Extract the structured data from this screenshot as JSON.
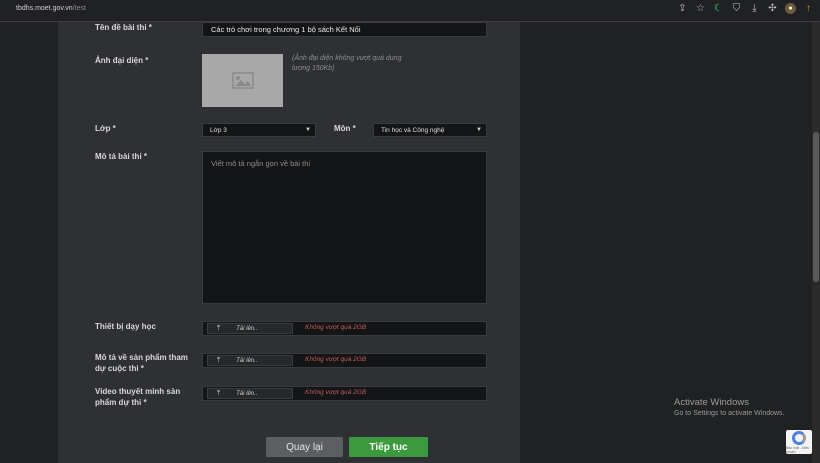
{
  "browser": {
    "url_host": "tbdhs.moet.gov.vn",
    "url_path": "/test"
  },
  "form": {
    "title_label": "Tên đề bài thi *",
    "title_value": "Các trò chơi trong chương 1 bộ sách Kết Nối",
    "avatar_label": "Ảnh đại diện *",
    "avatar_hint": "(Ảnh đại diện không vượt quá dung lượng 150Kb)",
    "grade_label": "Lớp *",
    "grade_value": "Lớp 3",
    "subject_label": "Môn *",
    "subject_value": "Tin học và Công nghệ",
    "desc_label": "Mô tả bài thi *",
    "desc_placeholder": "Viết mô tả ngắn gọn về bài thi",
    "uploads": [
      {
        "label": "Thiết bị dạy học",
        "button": "Tải lên..",
        "limit": "Không vượt quá 2GB"
      },
      {
        "label": "Mô tả về sản phẩm tham dự cuộc thi *",
        "button": "Tải lên..",
        "limit": "Không vượt quá 2GB"
      },
      {
        "label": "Video thuyết minh sản phẩm dự thi *",
        "button": "Tải lên..",
        "limit": "Không vượt quá 2GB"
      }
    ],
    "back_button": "Quay lại",
    "next_button": "Tiếp tục"
  },
  "overlay": {
    "activate_title": "Activate Windows",
    "activate_subtitle": "Go to Settings to activate Windows.",
    "captcha_text": "Bảo mật - Điều khoản"
  },
  "icons": [
    "share-icon",
    "star-icon",
    "moon-icon",
    "shield-icon",
    "download-icon",
    "puzzle-icon",
    "avatar-icon",
    "update-icon",
    "image-placeholder-icon",
    "upload-icon",
    "recaptcha-icon"
  ],
  "colors": {
    "accent_green": "#3b9a3d",
    "limit_red": "#c45a5a"
  }
}
